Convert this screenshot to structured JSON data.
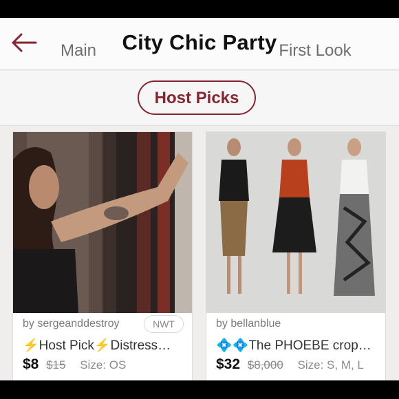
{
  "header": {
    "title": "City Chic Party",
    "back_icon": "back-arrow-icon",
    "accent": "#86242f"
  },
  "tabs": [
    {
      "label": "Main"
    },
    {
      "label": "Host Picks",
      "active": true
    },
    {
      "label": "First Look"
    }
  ],
  "listings": [
    {
      "seller": "by sergeanddestroy",
      "badge": "NWT",
      "title": "⚡️Host Pick⚡️Distress…",
      "price": "$8",
      "original_price": "$15",
      "size": "Size: OS"
    },
    {
      "seller": "by bellanblue",
      "title": "💠💠The PHOEBE crop…",
      "price": "$32",
      "original_price": "$8,000",
      "size": "Size: S, M, L"
    }
  ]
}
